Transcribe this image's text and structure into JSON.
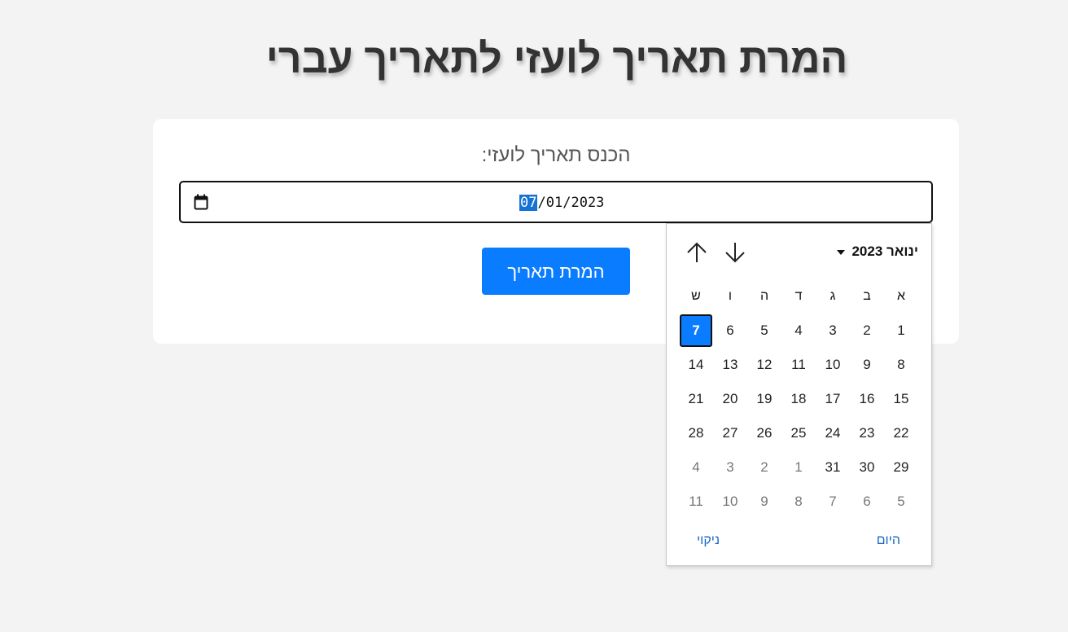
{
  "page": {
    "title": "המרת תאריך לועזי לתאריך עברי",
    "prompt": "הכנס תאריך לועזי:",
    "date_input": {
      "day": "07",
      "sep1": "/",
      "month": "01",
      "sep2": "/",
      "year": "2023"
    },
    "convert_button": "המרת תאריך"
  },
  "calendar": {
    "month_year": "ינואר 2023",
    "weekdays": [
      "א",
      "ב",
      "ג",
      "ד",
      "ה",
      "ו",
      "ש"
    ],
    "weeks": [
      [
        {
          "d": "1"
        },
        {
          "d": "2"
        },
        {
          "d": "3"
        },
        {
          "d": "4"
        },
        {
          "d": "5"
        },
        {
          "d": "6"
        },
        {
          "d": "7",
          "selected": true
        }
      ],
      [
        {
          "d": "8"
        },
        {
          "d": "9"
        },
        {
          "d": "10"
        },
        {
          "d": "11"
        },
        {
          "d": "12"
        },
        {
          "d": "13"
        },
        {
          "d": "14"
        }
      ],
      [
        {
          "d": "15"
        },
        {
          "d": "16"
        },
        {
          "d": "17"
        },
        {
          "d": "18"
        },
        {
          "d": "19"
        },
        {
          "d": "20"
        },
        {
          "d": "21"
        }
      ],
      [
        {
          "d": "22"
        },
        {
          "d": "23"
        },
        {
          "d": "24"
        },
        {
          "d": "25"
        },
        {
          "d": "26"
        },
        {
          "d": "27"
        },
        {
          "d": "28"
        }
      ],
      [
        {
          "d": "29"
        },
        {
          "d": "30"
        },
        {
          "d": "31"
        },
        {
          "d": "1",
          "other": true
        },
        {
          "d": "2",
          "other": true
        },
        {
          "d": "3",
          "other": true
        },
        {
          "d": "4",
          "other": true
        }
      ],
      [
        {
          "d": "5",
          "other": true
        },
        {
          "d": "6",
          "other": true
        },
        {
          "d": "7",
          "other": true
        },
        {
          "d": "8",
          "other": true
        },
        {
          "d": "9",
          "other": true
        },
        {
          "d": "10",
          "other": true
        },
        {
          "d": "11",
          "other": true
        }
      ]
    ],
    "today_button": "היום",
    "clear_button": "ניקוי"
  },
  "icons": {
    "calendar": "calendar-icon",
    "prev_month": "arrow-up-icon",
    "next_month": "arrow-down-icon",
    "dropdown": "caret-down-icon"
  },
  "colors": {
    "accent": "#0a7cff",
    "link": "#1a66c8",
    "background": "#f3f3f3"
  }
}
